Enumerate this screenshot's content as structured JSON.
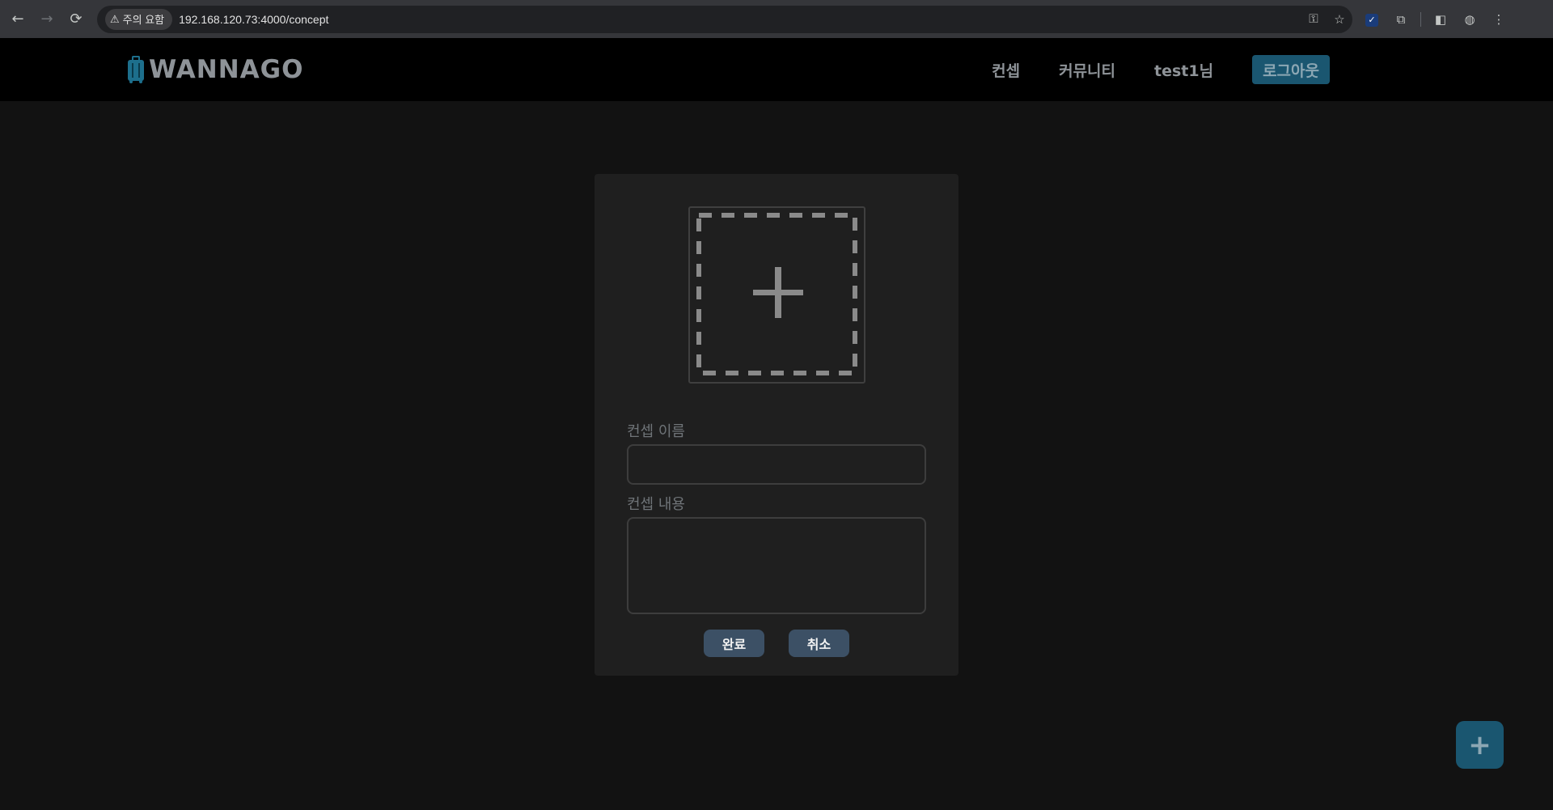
{
  "browser": {
    "back_icon": "←",
    "forward_icon": "→",
    "reload_icon": "⟳",
    "security_warning": "주의 요함",
    "warning_icon": "⚠",
    "url": "192.168.120.73:4000/concept",
    "key_icon": "⚿",
    "star_icon": "☆",
    "extension_check": "✓",
    "extensions_icon": "⧉",
    "sidepanel_icon": "◧",
    "profile_icon": "◍",
    "menu_icon": "⋮"
  },
  "header": {
    "logo_text": "WANNAGO",
    "nav": {
      "concept": "컨셉",
      "community": "커뮤니티",
      "user": "test1님",
      "logout": "로그아웃"
    }
  },
  "form": {
    "image_add_icon": "add-image-icon",
    "name_label": "컨셉 이름",
    "name_value": "",
    "content_label": "컨셉 내용",
    "content_value": "",
    "submit_label": "완료",
    "cancel_label": "취소"
  },
  "fab": {
    "label": "+"
  },
  "colors": {
    "page_bg": "#121212",
    "header_bg": "#000000",
    "card_bg": "#1f1f1f",
    "accent": "#1a5670",
    "button_bg": "#3c5065"
  }
}
